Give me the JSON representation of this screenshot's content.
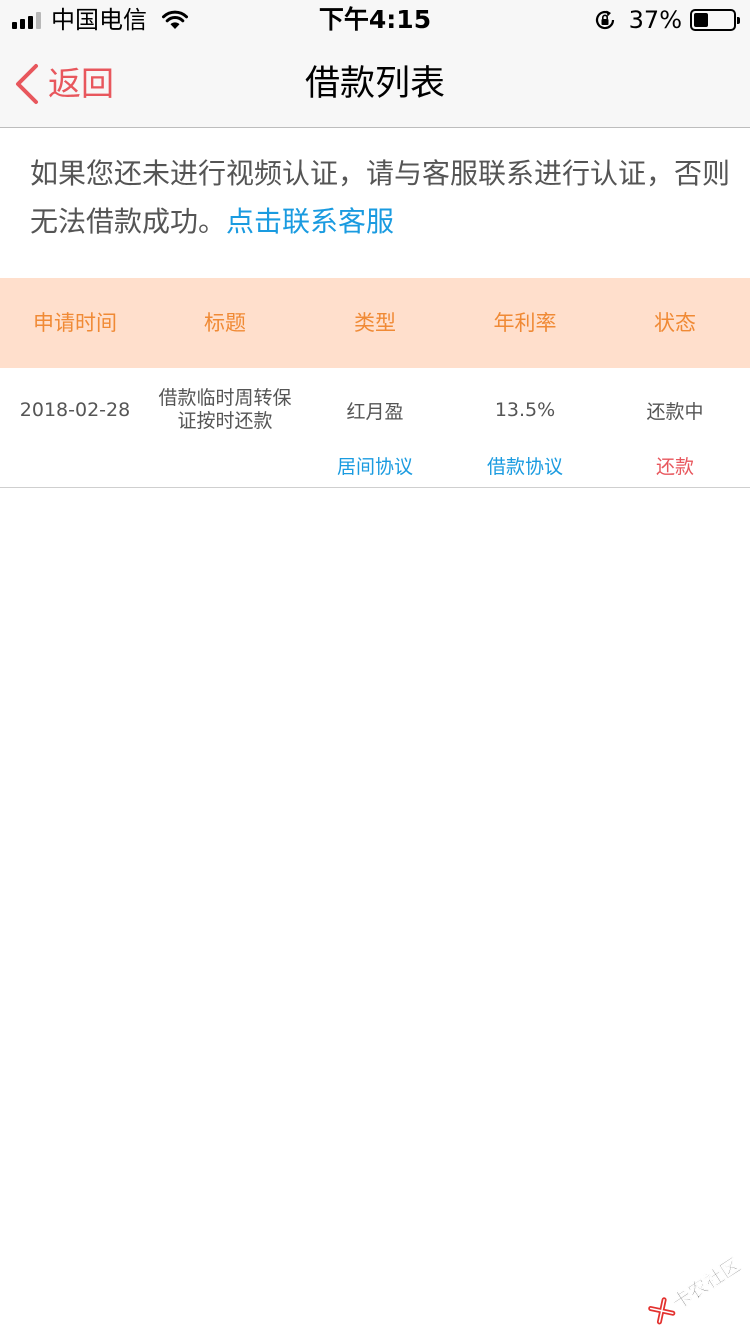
{
  "status_bar": {
    "carrier": "中国电信",
    "time": "下午4:15",
    "battery_percent": "37%",
    "battery_level": 0.37,
    "signal_bars": 3,
    "icons": [
      "signal-icon",
      "wifi-icon",
      "rotation-lock-icon",
      "battery-icon"
    ]
  },
  "nav": {
    "back_label": "返回",
    "title": "借款列表",
    "back_color": "#e8575d"
  },
  "notice": {
    "text": "如果您还未进行视频认证，请与客服联系进行认证，否则无法借款成功。",
    "link": "点击联系客服",
    "link_color": "#1a9be0"
  },
  "table": {
    "header_bg": "#ffdfcc",
    "header_color": "#f08a35",
    "headers": [
      "申请时间",
      "标题",
      "类型",
      "年利率",
      "状态"
    ],
    "rows": [
      {
        "date": "2018-02-28",
        "title": "借款临时周转保证按时还款",
        "type": "红月盈",
        "rate": "13.5%",
        "status": "还款中",
        "actions": {
          "broker_agreement": "居间协议",
          "loan_agreement": "借款协议",
          "repay": "还款"
        }
      }
    ]
  },
  "watermark": {
    "text": "卡农社区"
  }
}
